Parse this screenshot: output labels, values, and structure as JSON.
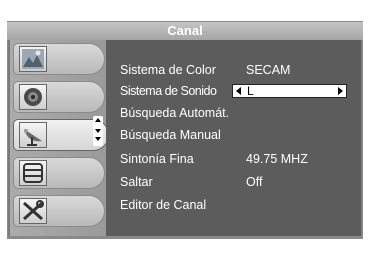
{
  "window": {
    "title": "Canal"
  },
  "sidebar": {
    "tabs": [
      {
        "icon": "picture-icon"
      },
      {
        "icon": "speaker-icon"
      },
      {
        "icon": "satellite-dish-icon",
        "selected": true
      },
      {
        "icon": "window-icon"
      },
      {
        "icon": "tools-icon"
      }
    ]
  },
  "menu": {
    "items": [
      {
        "label": "Sistema de Color",
        "value": "SECAM"
      },
      {
        "label": "Sistema de Sonido",
        "value": "L",
        "selector": true
      },
      {
        "label": "Búsqueda Automát.",
        "value": ""
      },
      {
        "label": "Búsqueda Manual",
        "value": ""
      },
      {
        "label": "Sintonía Fina",
        "value": "49.75 MHZ"
      },
      {
        "label": "Saltar",
        "value": "Off"
      },
      {
        "label": "Editor de Canal",
        "value": ""
      }
    ]
  },
  "colors": {
    "panel": "#5c5c5c",
    "sidebar": "#a0a0a0",
    "title": "#b0b0b0"
  }
}
